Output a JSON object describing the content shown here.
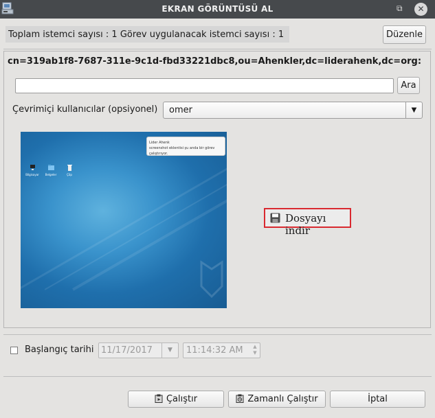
{
  "window": {
    "title": "EKRAN GÖRÜNTÜSÜ AL",
    "icons": [
      "app-icon",
      "restore-icon",
      "close-icon"
    ]
  },
  "summary": {
    "text": "Toplam istemci sayısı : 1  Görev uygulanacak istemci sayısı : 1",
    "edit_label": "Düzenle"
  },
  "target": {
    "dn": "cn=319ab1f8-7687-311e-9c1d-fbd33221dbc8,ou=Ahenkler,dc=liderahenk,dc=org:"
  },
  "search": {
    "value": "",
    "button_label": "Ara"
  },
  "online_users": {
    "label": "Çevrimiçi kullanıcılar (opsiyonel)",
    "selected": "omer"
  },
  "screenshot": {
    "notification_title": "Lider Ahenk",
    "notification_body": "screenshot eklentisi şu anda bir görev çalıştırıyor.",
    "desktop_icons": [
      "Bilgisayar",
      "Belgeler",
      "Çöp"
    ]
  },
  "download": {
    "label": "Dosyayı indir",
    "icon": "floppy-disk-icon"
  },
  "schedule": {
    "checkbox_checked": false,
    "label": "Başlangıç tarihi",
    "date": "11/17/2017",
    "time": "11:14:32 AM"
  },
  "actions": {
    "run": "Çalıştır",
    "scheduled_run": "Zamanlı Çalıştır",
    "cancel": "İptal"
  },
  "colors": {
    "titlebar": "#46494c",
    "highlight_border": "#d9282f",
    "background": "#e4e3e1"
  }
}
